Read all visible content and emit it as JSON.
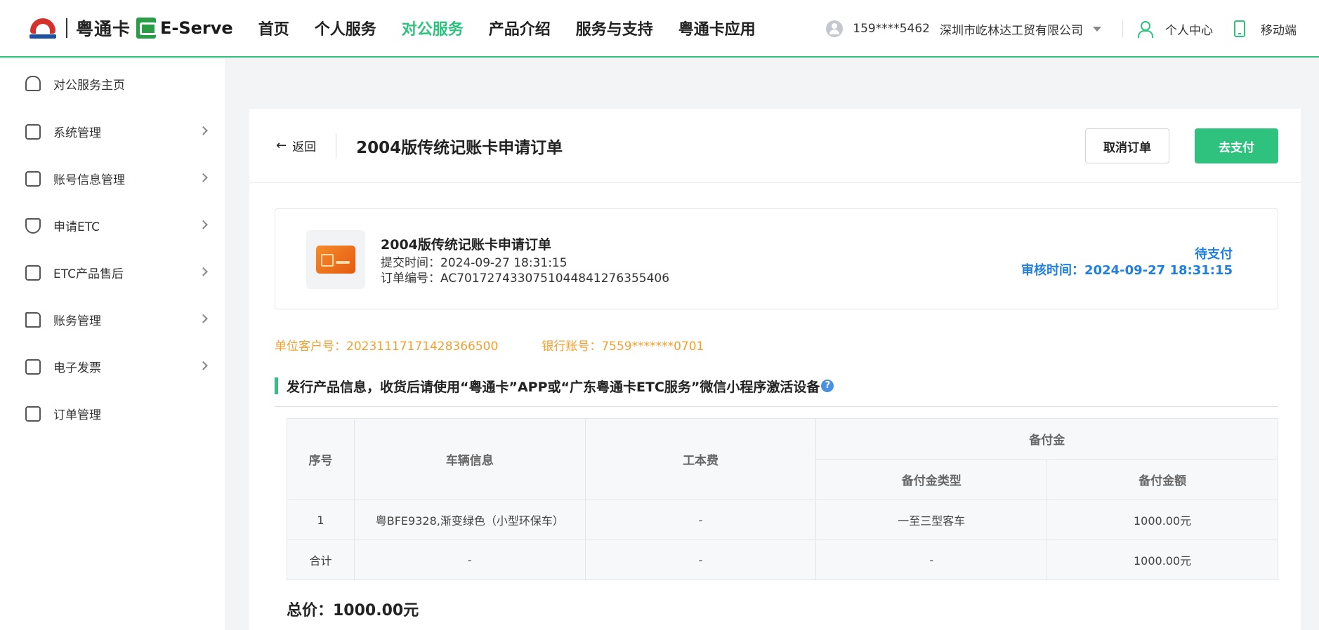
{
  "brand": {
    "name": "粤通卡",
    "product": "E-Serve"
  },
  "nav": [
    {
      "label": "首页",
      "active": false
    },
    {
      "label": "个人服务",
      "active": false
    },
    {
      "label": "对公服务",
      "active": true
    },
    {
      "label": "产品介绍",
      "active": false
    },
    {
      "label": "服务与支持",
      "active": false
    },
    {
      "label": "粤通卡应用",
      "active": false
    }
  ],
  "user": {
    "phone": "159****5462",
    "company": "深圳市屹林达工贸有限公司",
    "personal_center": "个人中心",
    "mobile": "移动端"
  },
  "sidebar": [
    {
      "label": "对公服务主页",
      "icon": "home-icon",
      "chevron": false
    },
    {
      "label": "系统管理",
      "icon": "system-settings-icon",
      "chevron": true
    },
    {
      "label": "账号信息管理",
      "icon": "account-info-icon",
      "chevron": true
    },
    {
      "label": "申请ETC",
      "icon": "etc-shield-icon",
      "chevron": true
    },
    {
      "label": "ETC产品售后",
      "icon": "after-sales-icon",
      "chevron": true
    },
    {
      "label": "账务管理",
      "icon": "folder-icon",
      "chevron": true
    },
    {
      "label": "电子发票",
      "icon": "invoice-icon",
      "chevron": true
    },
    {
      "label": "订单管理",
      "icon": "order-clipboard-icon",
      "chevron": false
    }
  ],
  "header": {
    "back": "返回",
    "title": "2004版传统记账卡申请订单",
    "cancel": "取消订单",
    "pay": "去支付"
  },
  "order": {
    "name": "2004版传统记账卡申请订单",
    "submit_time": "提交时间：2024-09-27 18:31:15",
    "order_no": "订单编号：AC7017274330751044841276355406",
    "status": "待支付",
    "review_time": "审核时间：2024-09-27 18:31:15"
  },
  "account": {
    "customer_no": "单位客户号：2023111717142836650​0",
    "bank_no": "银行账号：7559*******0701"
  },
  "section": {
    "title": "发行产品信息，收货后请使用“粤通卡”APP或“广东粤通卡ETC服务”微信小程序激活设备",
    "help": "?"
  },
  "table": {
    "headers": {
      "seq": "序号",
      "vehicle": "车辆信息",
      "fee": "工本费",
      "prepaid": "备付金",
      "prepaid_type": "备付金类型",
      "prepaid_amount": "备付金额"
    },
    "rows": [
      {
        "seq": "1",
        "vehicle": "粤BFE9328,渐变绿色（小型环保车）",
        "fee": "-",
        "type": "一至三型客车",
        "amount": "1000.00元"
      },
      {
        "seq": "合计",
        "vehicle": "-",
        "fee": "-",
        "type": "-",
        "amount": "1000.00元"
      }
    ]
  },
  "total": "总价：1000.00元"
}
